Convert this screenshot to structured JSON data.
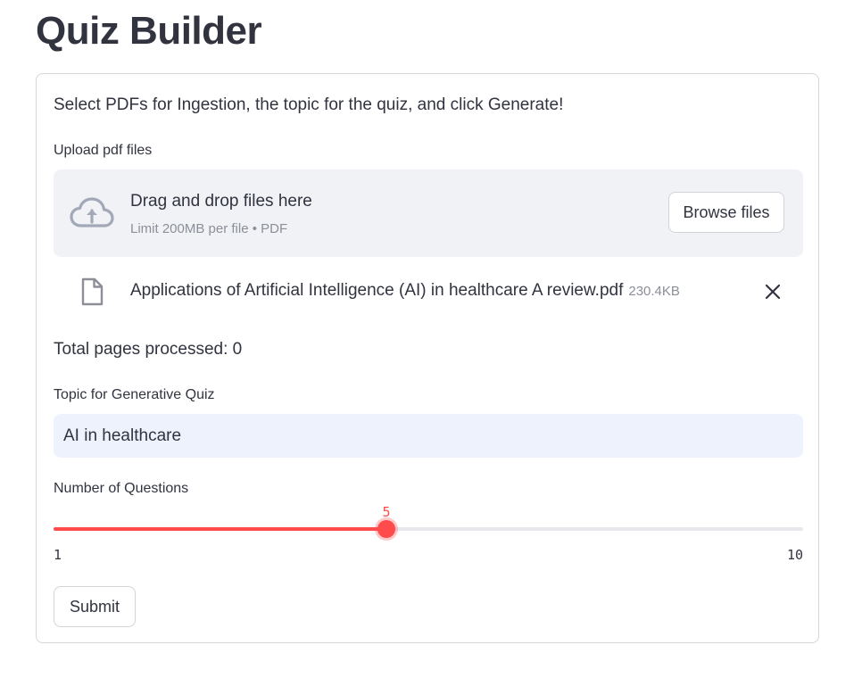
{
  "page": {
    "title": "Quiz Builder"
  },
  "form": {
    "intro": "Select PDFs for Ingestion, the topic for the quiz, and click Generate!",
    "upload": {
      "label": "Upload pdf files",
      "dropzone_title": "Drag and drop files here",
      "dropzone_sub": "Limit 200MB per file • PDF",
      "browse_label": "Browse files",
      "icon": "cloud-upload-icon"
    },
    "files": [
      {
        "name": "Applications of Artificial Intelligence (AI) in healthcare A review.pdf",
        "size": "230.4KB",
        "icon": "file-icon",
        "remove_icon": "close-icon"
      }
    ],
    "status": "Total pages processed: 0",
    "topic": {
      "label": "Topic for Generative Quiz",
      "value": "AI in healthcare"
    },
    "questions": {
      "label": "Number of Questions",
      "value": 5,
      "value_label": "5",
      "min": 1,
      "max": 10,
      "min_label": "1",
      "max_label": "10"
    },
    "submit_label": "Submit"
  },
  "colors": {
    "accent": "#ff4b4b",
    "text": "#31333f",
    "muted": "#8c8f98",
    "dropzone_bg": "#f0f2f6",
    "input_bg": "#eef2fc"
  }
}
